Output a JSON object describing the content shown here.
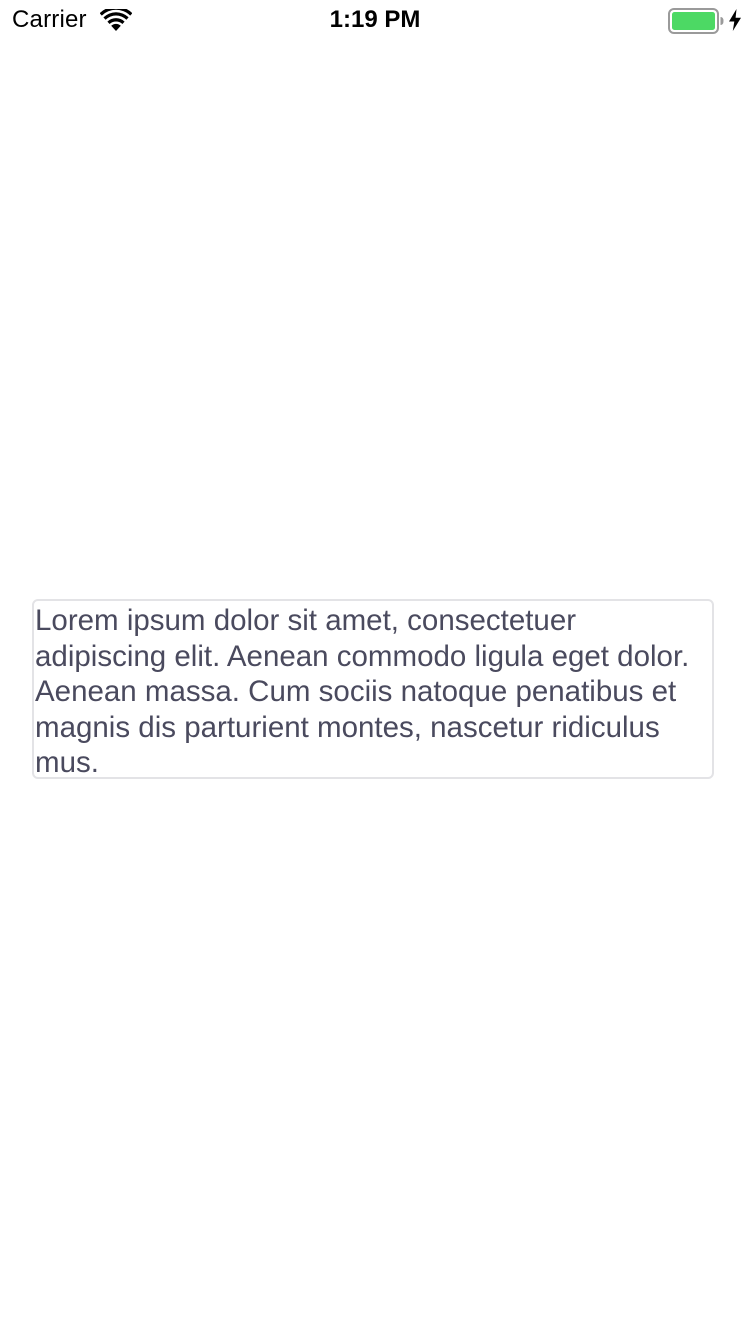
{
  "status_bar": {
    "carrier": "Carrier",
    "time": "1:19 PM",
    "wifi_icon": "wifi-icon",
    "battery_icon": "battery-icon",
    "battery_color": "#4cd964",
    "charging_icon": "bolt-icon"
  },
  "main": {
    "text_box": {
      "text": "Lorem ipsum dolor sit amet, consectetuer adipiscing elit. Aenean commodo ligula eget dolor. Aenean massa. Cum sociis natoque penatibus et magnis dis parturient montes, nascetur ridiculus mus.",
      "text_color": "#4a4a5e",
      "border_color": "#e3e3e6"
    }
  }
}
